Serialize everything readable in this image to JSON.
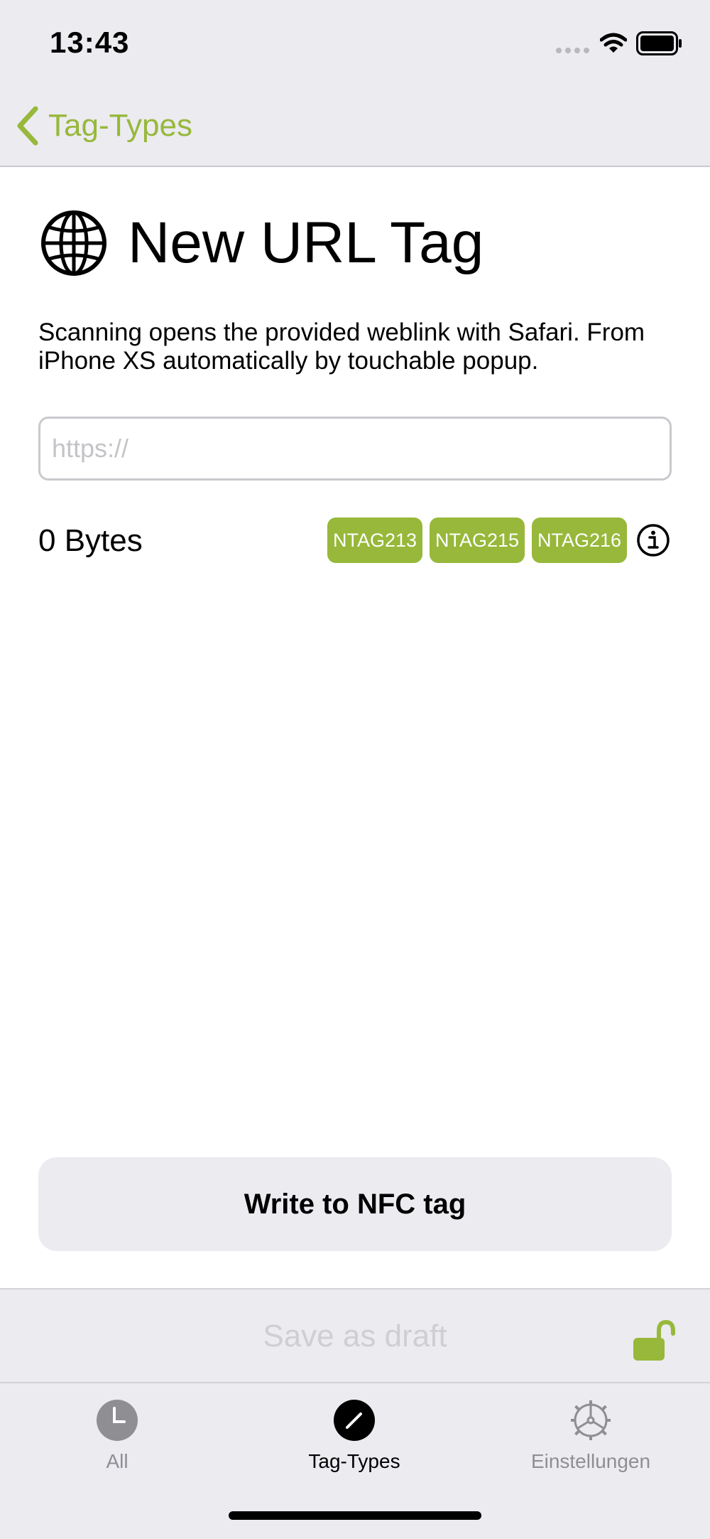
{
  "status_bar": {
    "time": "13:43"
  },
  "nav": {
    "back_label": "Tag-Types"
  },
  "main": {
    "title": "New URL Tag",
    "title_icon": "globe-icon",
    "description": "Scanning opens the provided weblink with Safari. From iPhone XS automatically by touchable popup.",
    "url_input": {
      "value": "",
      "placeholder": "https://"
    },
    "bytes_label": "0 Bytes",
    "chips": [
      "NTAG213",
      "NTAG215",
      "NTAG216"
    ],
    "write_button_label": "Write to NFC tag"
  },
  "draft_bar": {
    "save_label": "Save as draft",
    "lock_icon": "unlocked-lock-icon"
  },
  "tab_bar": {
    "tabs": [
      {
        "label": "All",
        "icon": "clock-icon",
        "active": false
      },
      {
        "label": "Tag-Types",
        "icon": "pencil-icon",
        "active": true
      },
      {
        "label": "Einstellungen",
        "icon": "gear-icon",
        "active": false
      }
    ]
  },
  "colors": {
    "accent": "#97b83a",
    "background_grey": "#ebebf0",
    "inactive_grey": "#8e8e93"
  }
}
